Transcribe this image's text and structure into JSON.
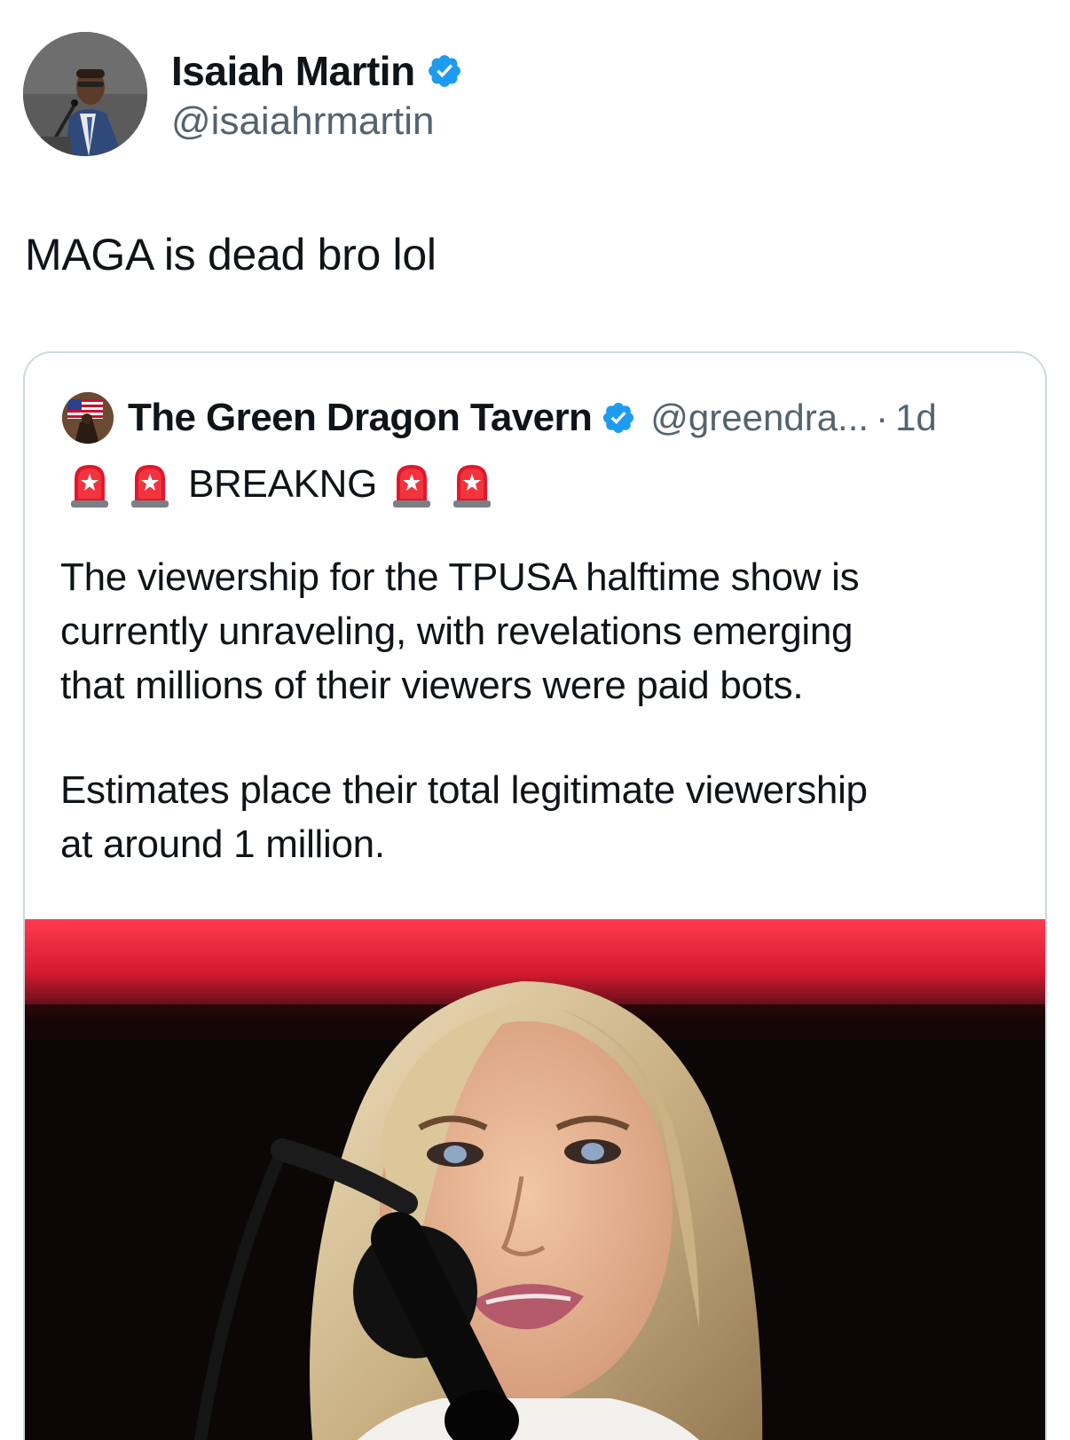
{
  "author": {
    "name": "Isaiah Martin",
    "handle": "@isaiahrmartin",
    "verified": true,
    "avatar_icon": "speaker-at-podium-avatar"
  },
  "tweet": {
    "text": "MAGA is dead bro lol"
  },
  "quoted_tweet": {
    "author_name": "The Green Dragon Tavern",
    "handle": "@greendra...",
    "separator": "·",
    "time": "1d",
    "verified": true,
    "avatar_icon": "flag-avatar",
    "headline": "BREAKNG",
    "headline_icon": "police-siren-icon",
    "paragraphs": [
      "The viewership for the TPUSA halftime show is\ncurrently unraveling, with revelations emerging\nthat millions of their viewers were paid bots.",
      "Estimates place their total legitimate viewership\nat around 1 million."
    ],
    "media_icon": "woman-at-microphone-photo"
  },
  "colors": {
    "text_primary": "#0f1419",
    "text_secondary": "#536471",
    "verified_blue": "#1d9bf0",
    "card_border": "#cfd9de",
    "stage_red": "#e0203a"
  }
}
